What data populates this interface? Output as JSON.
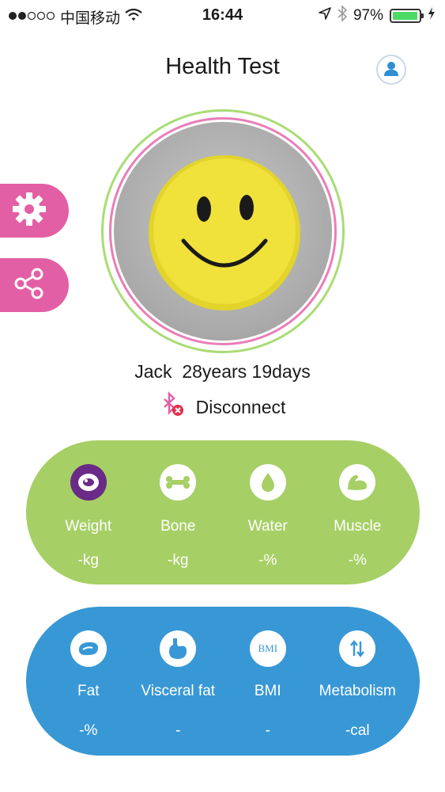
{
  "status_bar": {
    "carrier": "中国移动",
    "time": "16:44",
    "battery_text": "97%",
    "battery_level": 0.97,
    "signal_icon": "signal-dots-icon",
    "wifi_icon": "wifi-icon",
    "location_icon": "location-arrow-icon",
    "bluetooth_icon": "bluetooth-icon",
    "charging_icon": "charging-bolt-icon"
  },
  "header": {
    "title": "Health Test",
    "profile_icon": "user-icon"
  },
  "side_buttons": {
    "settings_icon": "gear-icon",
    "share_icon": "share-icon"
  },
  "user": {
    "name": "Jack",
    "age": "28years 19days"
  },
  "connection": {
    "status": "Disconnect",
    "icon": "bluetooth-disconnected-icon"
  },
  "colors": {
    "accent_pink": "#e35fa5",
    "panel_green": "#a6cf65",
    "panel_blue": "#3898d6",
    "weight_icon_purple": "#6a2a87"
  },
  "metrics_top": [
    {
      "label": "Weight",
      "value": "-kg",
      "icon": "weight-icon"
    },
    {
      "label": "Bone",
      "value": "-kg",
      "icon": "bone-icon"
    },
    {
      "label": "Water",
      "value": "-%",
      "icon": "water-drop-icon"
    },
    {
      "label": "Muscle",
      "value": "-%",
      "icon": "muscle-icon"
    }
  ],
  "metrics_bottom": [
    {
      "label": "Fat",
      "value": "-%",
      "icon": "fat-icon"
    },
    {
      "label": "Visceral fat",
      "value": "-",
      "icon": "stomach-icon"
    },
    {
      "label": "BMI",
      "value": "-",
      "icon": "bmi-icon",
      "icon_text": "BMI"
    },
    {
      "label": "Metabolism",
      "value": "-cal",
      "icon": "metabolism-icon"
    }
  ]
}
